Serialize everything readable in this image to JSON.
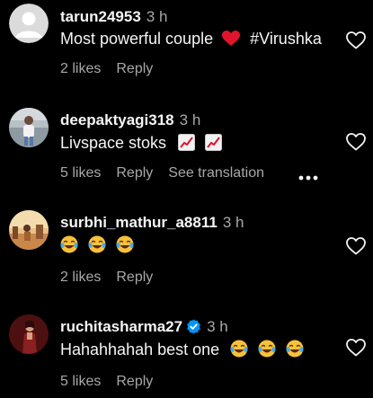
{
  "colors": {
    "background": "#000000",
    "primary_text": "#f5f5f5",
    "secondary_text": "#a8a8a8",
    "heart_red": "#e0142d",
    "verified_blue": "#0095f6"
  },
  "comments": [
    {
      "username": "tarun24953",
      "time": "3 h",
      "text": "Most powerful couple",
      "inline_extra": "#Virushka",
      "inline_icon": "red-heart-emoji-icon",
      "likes": "2 likes",
      "reply": "Reply"
    },
    {
      "username": "deepaktyagi318",
      "time": "3 h",
      "text": "Livspace stoks",
      "inline_icon": "chart-increasing-emoji-icon",
      "likes": "5 likes",
      "reply": "Reply",
      "see_translation": "See translation",
      "more_icon": "more-options-icon"
    },
    {
      "username": "surbhi_mathur_a8811",
      "time": "3 h",
      "text": "",
      "inline_icon": "laughing-tears-emoji-icon",
      "likes": "2 likes",
      "reply": "Reply"
    },
    {
      "username": "ruchitasharma27",
      "time": "3 h",
      "verified": true,
      "text": "Hahahhahah best one",
      "inline_icon": "laughing-tears-emoji-icon",
      "likes": "5 likes",
      "reply": "Reply"
    }
  ]
}
